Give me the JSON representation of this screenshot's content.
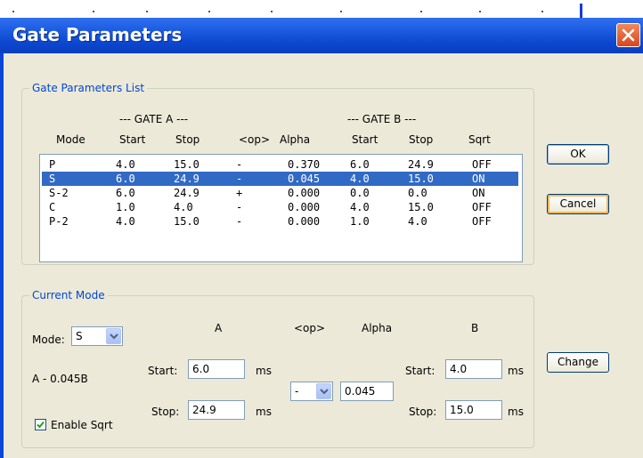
{
  "dialog": {
    "title": "Gate Parameters"
  },
  "list_group": {
    "legend": "Gate Parameters List",
    "header_groups": {
      "gate_a": "--- GATE A ---",
      "gate_b": "--- GATE B ---"
    },
    "columns": [
      "Mode",
      "Start",
      "Stop",
      "<op>",
      "Alpha",
      "Start",
      "Stop",
      "Sqrt"
    ],
    "rows": [
      [
        "P",
        "4.0",
        "15.0",
        "-",
        "0.370",
        "6.0",
        "24.9",
        "OFF"
      ],
      [
        "S",
        "6.0",
        "24.9",
        "-",
        "0.045",
        "4.0",
        "15.0",
        "ON"
      ],
      [
        "S-2",
        "6.0",
        "24.9",
        "+",
        "0.000",
        "0.0",
        "0.0",
        "ON"
      ],
      [
        "C",
        "1.0",
        "4.0",
        "-",
        "0.000",
        "4.0",
        "15.0",
        "OFF"
      ],
      [
        "P-2",
        "4.0",
        "15.0",
        "-",
        "0.000",
        "1.0",
        "4.0",
        "OFF"
      ]
    ],
    "selected_row_index": 1
  },
  "buttons": {
    "ok": "OK",
    "cancel": "Cancel",
    "change": "Change"
  },
  "current_mode": {
    "legend": "Current Mode",
    "mode_label": "Mode:",
    "mode_value": "S",
    "expression": "A - 0.045B",
    "enable_sqrt_label": "Enable Sqrt",
    "enable_sqrt_checked": true,
    "col_a": "A",
    "col_op": "<op>",
    "col_alpha": "Alpha",
    "col_b": "B",
    "a_start_label": "Start:",
    "a_start_value": "6.0",
    "a_stop_label": "Stop:",
    "a_stop_value": "24.9",
    "unit": "ms",
    "op_value": "-",
    "alpha_value": "0.045",
    "b_start_label": "Start:",
    "b_start_value": "4.0",
    "b_stop_label": "Stop:",
    "b_stop_value": "15.0"
  },
  "colors": {
    "titlebar": "#0a46d8",
    "selection": "#316ac5",
    "legend_text": "#0046d5",
    "close_button": "#d8451f",
    "dialog_bg": "#ece9d8"
  },
  "icons": {
    "close": "close-x-icon",
    "dropdown": "chevron-down-icon",
    "check": "checkmark-icon"
  }
}
